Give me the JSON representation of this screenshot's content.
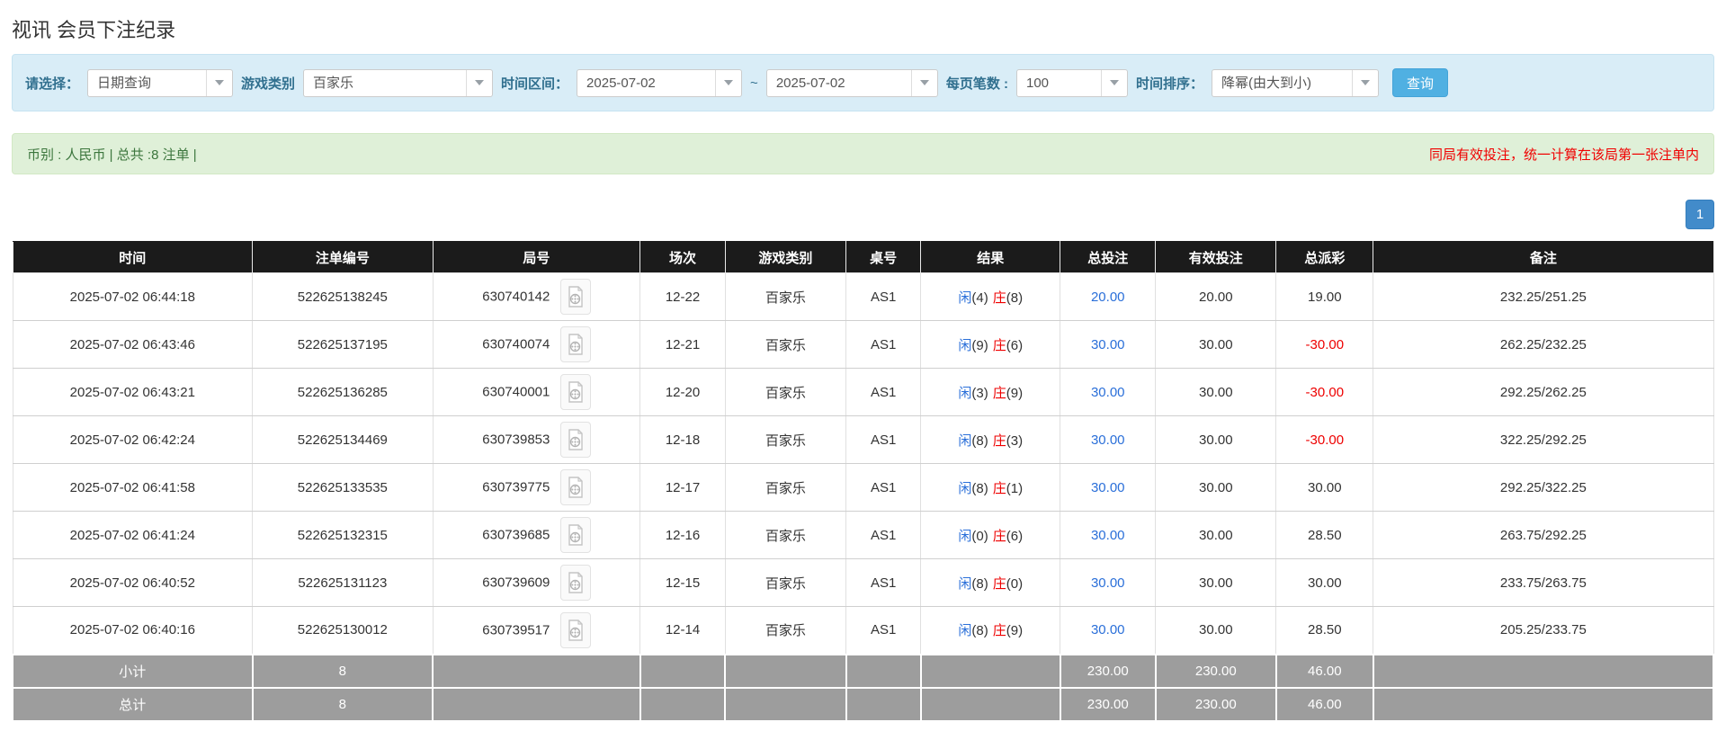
{
  "page": {
    "title": "视讯 会员下注纪录"
  },
  "filters": {
    "select_label": "请选择：",
    "select_value": "日期查询",
    "game_type_label": "游戏类别",
    "game_type_value": "百家乐",
    "time_range_label": "时间区间：",
    "date_from": "2025-07-02",
    "tilde": "~",
    "date_to": "2025-07-02",
    "page_size_label": "每页笔数 :",
    "page_size_value": "100",
    "sort_label": "时间排序：",
    "sort_value": "降幂(由大到小)",
    "search_button": "查询"
  },
  "summary": {
    "left_text": "币别 : 人民币 | 总共 :8 注单 |",
    "right_note": "同局有效投注，统一计算在该局第一张注单内"
  },
  "pagination": {
    "pages": [
      "1"
    ]
  },
  "icons": {
    "chevron_down": "caret-down-triangle",
    "video_replay": "film-document-icon"
  },
  "colors": {
    "filter_bg": "#d9edf7",
    "summary_bg": "#dff0d8",
    "summary_text": "#3c763d",
    "note_red": "#f00000",
    "header_bg": "#1b1b1b",
    "totals_bg": "#9d9d9d",
    "link_blue": "#2a6fd9",
    "banker_red": "#ee0000",
    "search_button_bg": "#50b0e2",
    "page_button_bg": "#428bca"
  },
  "table": {
    "columns": [
      "时间",
      "注单编号",
      "局号",
      "场次",
      "游戏类别",
      "桌号",
      "结果",
      "总投注",
      "有效投注",
      "总派彩",
      "备注"
    ],
    "rows": [
      {
        "time": "2025-07-02 06:44:18",
        "bet_no": "522625138245",
        "round_no": "630740142",
        "session": "12-22",
        "game": "百家乐",
        "table_no": "AS1",
        "result": {
          "player_label": "闲",
          "player_score": "(4)",
          "banker_label": "庄",
          "banker_score": "(8)"
        },
        "total_bet": "20.00",
        "valid_bet": "20.00",
        "payout": "19.00",
        "remark": "232.25/251.25"
      },
      {
        "time": "2025-07-02 06:43:46",
        "bet_no": "522625137195",
        "round_no": "630740074",
        "session": "12-21",
        "game": "百家乐",
        "table_no": "AS1",
        "result": {
          "player_label": "闲",
          "player_score": "(9)",
          "banker_label": "庄",
          "banker_score": "(6)"
        },
        "total_bet": "30.00",
        "valid_bet": "30.00",
        "payout": "-30.00",
        "remark": "262.25/232.25"
      },
      {
        "time": "2025-07-02 06:43:21",
        "bet_no": "522625136285",
        "round_no": "630740001",
        "session": "12-20",
        "game": "百家乐",
        "table_no": "AS1",
        "result": {
          "player_label": "闲",
          "player_score": "(3)",
          "banker_label": "庄",
          "banker_score": "(9)"
        },
        "total_bet": "30.00",
        "valid_bet": "30.00",
        "payout": "-30.00",
        "remark": "292.25/262.25"
      },
      {
        "time": "2025-07-02 06:42:24",
        "bet_no": "522625134469",
        "round_no": "630739853",
        "session": "12-18",
        "game": "百家乐",
        "table_no": "AS1",
        "result": {
          "player_label": "闲",
          "player_score": "(8)",
          "banker_label": "庄",
          "banker_score": "(3)"
        },
        "total_bet": "30.00",
        "valid_bet": "30.00",
        "payout": "-30.00",
        "remark": "322.25/292.25"
      },
      {
        "time": "2025-07-02 06:41:58",
        "bet_no": "522625133535",
        "round_no": "630739775",
        "session": "12-17",
        "game": "百家乐",
        "table_no": "AS1",
        "result": {
          "player_label": "闲",
          "player_score": "(8)",
          "banker_label": "庄",
          "banker_score": "(1)"
        },
        "total_bet": "30.00",
        "valid_bet": "30.00",
        "payout": "30.00",
        "remark": "292.25/322.25"
      },
      {
        "time": "2025-07-02 06:41:24",
        "bet_no": "522625132315",
        "round_no": "630739685",
        "session": "12-16",
        "game": "百家乐",
        "table_no": "AS1",
        "result": {
          "player_label": "闲",
          "player_score": "(0)",
          "banker_label": "庄",
          "banker_score": "(6)"
        },
        "total_bet": "30.00",
        "valid_bet": "30.00",
        "payout": "28.50",
        "remark": "263.75/292.25"
      },
      {
        "time": "2025-07-02 06:40:52",
        "bet_no": "522625131123",
        "round_no": "630739609",
        "session": "12-15",
        "game": "百家乐",
        "table_no": "AS1",
        "result": {
          "player_label": "闲",
          "player_score": "(8)",
          "banker_label": "庄",
          "banker_score": "(0)"
        },
        "total_bet": "30.00",
        "valid_bet": "30.00",
        "payout": "30.00",
        "remark": "233.75/263.75"
      },
      {
        "time": "2025-07-02 06:40:16",
        "bet_no": "522625130012",
        "round_no": "630739517",
        "session": "12-14",
        "game": "百家乐",
        "table_no": "AS1",
        "result": {
          "player_label": "闲",
          "player_score": "(8)",
          "banker_label": "庄",
          "banker_score": "(9)"
        },
        "total_bet": "30.00",
        "valid_bet": "30.00",
        "payout": "28.50",
        "remark": "205.25/233.75"
      }
    ],
    "subtotal": {
      "label": "小计",
      "count": "8",
      "total_bet": "230.00",
      "valid_bet": "230.00",
      "payout": "46.00"
    },
    "grand_total": {
      "label": "总计",
      "count": "8",
      "total_bet": "230.00",
      "valid_bet": "230.00",
      "payout": "46.00"
    }
  }
}
